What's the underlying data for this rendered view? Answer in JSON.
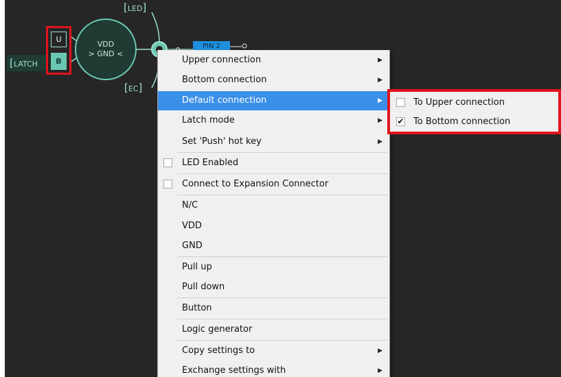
{
  "canvas": {
    "background": "#262626",
    "accent": "#6cc7b2",
    "latch_label": "LATCH",
    "upper_cell": "U",
    "bottom_cell": "B",
    "vdd_line": "VDD",
    "gnd_line": "> GND <",
    "led_tag": "LED",
    "ec_tag": "EC",
    "pin_label": "PIN 2"
  },
  "context_menu": {
    "highlight_color": "#3a8fe8",
    "items": [
      {
        "label": "Upper connection",
        "submenu": true
      },
      {
        "label": "Bottom connection",
        "submenu": true
      },
      {
        "label": "Default connection",
        "submenu": true,
        "highlighted": true
      },
      {
        "label": "Latch mode",
        "submenu": true
      },
      {
        "label": "Set 'Push' hot key",
        "submenu": true
      },
      {
        "label": "LED Enabled",
        "checkbox": true,
        "checked": false
      },
      {
        "label": "Connect to Expansion Connector",
        "checkbox": true,
        "checked": false
      },
      {
        "label": "N/C"
      },
      {
        "label": "VDD"
      },
      {
        "label": "GND"
      },
      {
        "label": "Pull up"
      },
      {
        "label": "Pull down"
      },
      {
        "label": "Button"
      },
      {
        "label": "Logic generator"
      },
      {
        "label": "Copy settings to",
        "submenu": true
      },
      {
        "label": "Exchange settings with",
        "submenu": true
      }
    ],
    "submenu_arrow": "▶"
  },
  "default_connection_submenu": {
    "items": [
      {
        "label": "To Upper connection",
        "checked": false
      },
      {
        "label": "To Bottom connection",
        "checked": true,
        "mark": "✔"
      }
    ]
  },
  "highlight_frame_color": "#e0141c"
}
